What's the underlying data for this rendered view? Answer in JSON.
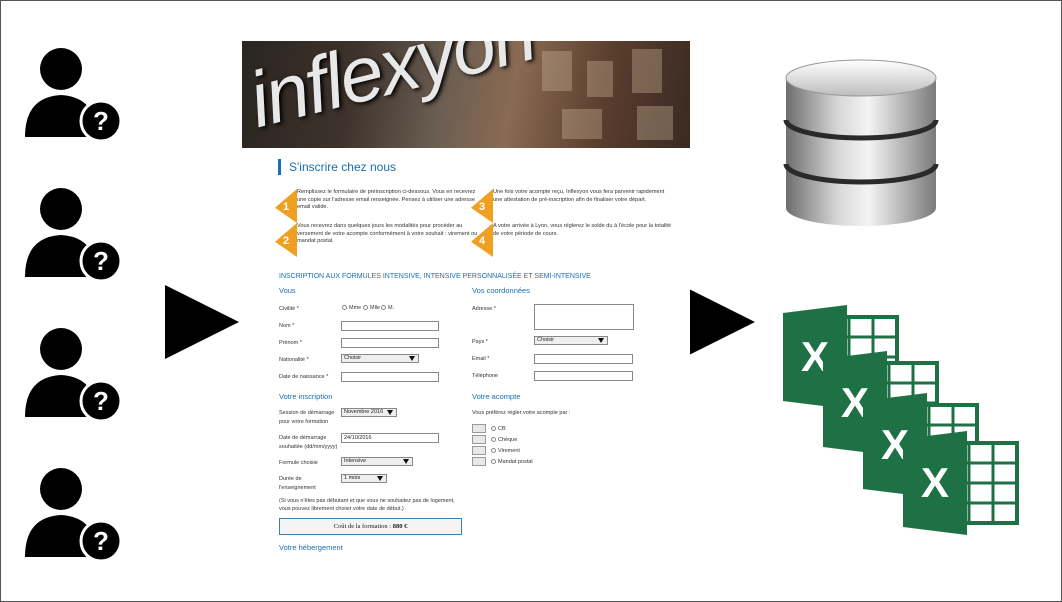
{
  "form": {
    "logo_text": "inflexyon",
    "title": "S'inscrire chez nous",
    "steps": [
      {
        "num": "1",
        "text": "Remplissez le formulaire de préinscription ci-dessous. Vous en recevrez une copie sur l'adresse email renseignée. Pensez à utiliser une adresse email valide."
      },
      {
        "num": "2",
        "text": "Vous recevrez dans quelques jours les modalités pour procéder au versement de votre acompte conformément à votre souhait : virement ou mandat postal."
      },
      {
        "num": "3",
        "text": "Une fois votre acompte reçu, Inflexyon vous fera parvenir rapidement une attestation de pré-inscription afin de finaliser votre départ."
      },
      {
        "num": "4",
        "text": "A votre arrivée à Lyon, vous réglerez le solde du à l'école pour la totalité de votre période de cours."
      }
    ],
    "section_heading": "INSCRIPTION AUX FORMULES INTENSIVE, INTENSIVE PERSONNALISÉE ET SEMI-INTENSIVE",
    "vous": {
      "heading": "Vous",
      "civilite_label": "Civilité *",
      "civilite_options": [
        "Mme",
        "Mlle",
        "M."
      ],
      "nom_label": "Nom *",
      "prenom_label": "Prénom *",
      "nationalite_label": "Nationalité *",
      "nationalite_value": "Choisir",
      "naissance_label": "Date de naissance *"
    },
    "coordonnees": {
      "heading": "Vos coordonnées",
      "adresse_label": "Adresse *",
      "pays_label": "Pays *",
      "pays_value": "Choisir",
      "email_label": "Email *",
      "telephone_label": "Téléphone"
    },
    "inscription": {
      "heading": "Votre inscription",
      "session_label_1": "Session de démarrage",
      "session_label_2": "pour votre formation",
      "session_value": "Novembre 2016",
      "date_label_1": "Date de démarrage",
      "date_label_2": "souhaitée (dd/mm/yyyy)",
      "date_value": "24/10/2016",
      "formule_label": "Formule choisie",
      "formule_value": "Intensive",
      "duree_label_1": "Durée de",
      "duree_label_2": "l'enseignement",
      "duree_value": "1 mois",
      "note_1": "(Si vous n'êtes pas débutant et que vous ne souhaitez pas de logement,",
      "note_2": "vous pouvez librement choisir votre date de début.)",
      "cost_label": "Coût de la formation :",
      "cost_value": "880 €"
    },
    "acompte": {
      "heading": "Votre acompte",
      "intro": "Vous préférez régler votre acompte par :",
      "options": [
        "CB",
        "Chèque",
        "Virement",
        "Mandat postal"
      ]
    },
    "hebergement_heading": "Votre hébergement"
  },
  "icons": {
    "users": [
      "user-question-icon",
      "user-question-icon",
      "user-question-icon",
      "user-question-icon"
    ],
    "arrows": [
      "arrow-right-icon",
      "arrow-right-icon"
    ],
    "database": "database-icon",
    "spreadsheets": [
      "excel-icon",
      "excel-icon",
      "excel-icon",
      "excel-icon"
    ],
    "excel_letter": "X"
  },
  "colors": {
    "accent_blue": "#1a6fb3",
    "step_orange": "#f0a020",
    "excel_green": "#1e7145"
  }
}
